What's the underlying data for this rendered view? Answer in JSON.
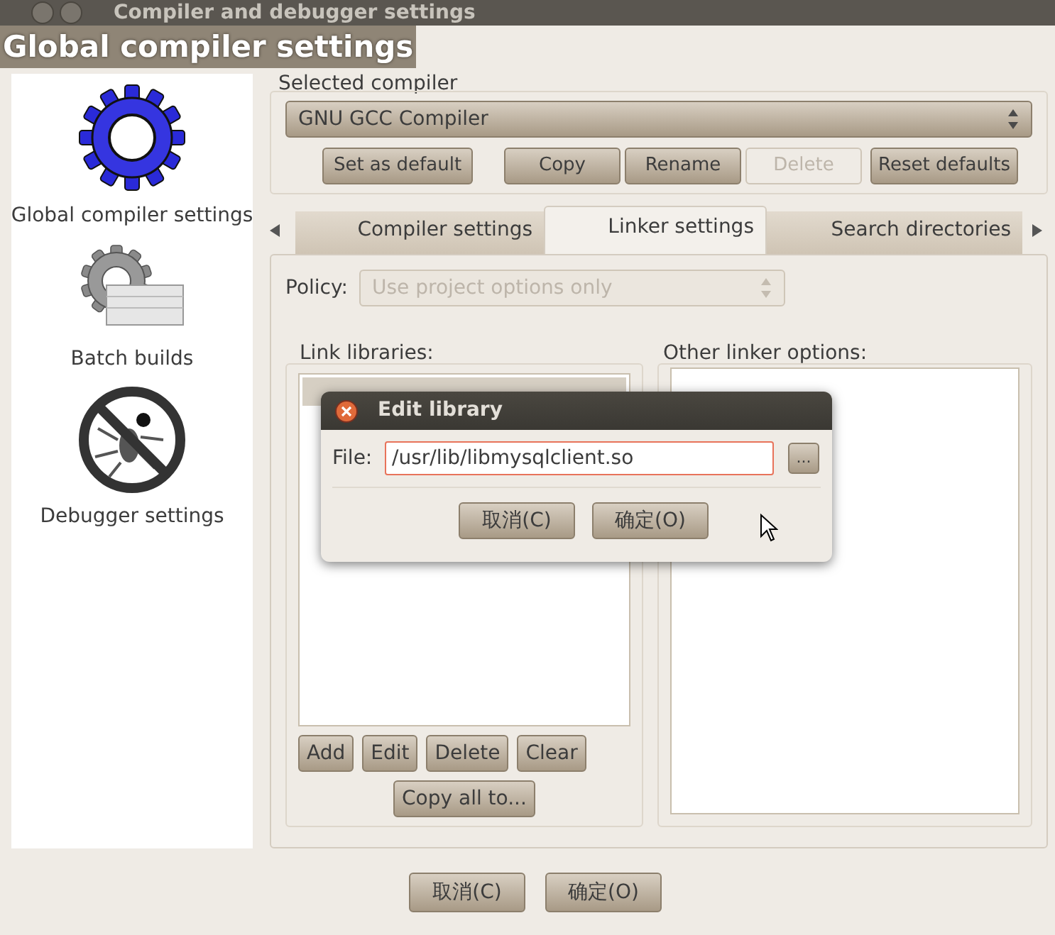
{
  "window": {
    "title": "Compiler and debugger settings",
    "heading": "Global compiler settings"
  },
  "sidebar": {
    "items": [
      {
        "label": "Global compiler settings",
        "kind": "gear"
      },
      {
        "label": "Batch builds",
        "kind": "batch"
      },
      {
        "label": "Debugger settings",
        "kind": "nobug"
      }
    ]
  },
  "selected_compiler": {
    "label": "Selected compiler",
    "value": "GNU GCC Compiler"
  },
  "compiler_buttons": [
    {
      "label": "Set as default",
      "disabled": false
    },
    {
      "label": "Copy",
      "disabled": false
    },
    {
      "label": "Rename",
      "disabled": false
    },
    {
      "label": "Delete",
      "disabled": true
    },
    {
      "label": "Reset defaults",
      "disabled": false
    }
  ],
  "tabs": [
    {
      "label": "Compiler settings",
      "selected": false
    },
    {
      "label": "Linker settings",
      "selected": true
    },
    {
      "label": "Search directories",
      "selected": false
    }
  ],
  "policy": {
    "label": "Policy:",
    "value": "Use project options only",
    "disabled": true
  },
  "link_libraries": {
    "label": "Link libraries:",
    "buttons": [
      "Add",
      "Edit",
      "Delete",
      "Clear"
    ],
    "copy_button": "Copy all to..."
  },
  "other_linker_options": {
    "label": "Other linker options:"
  },
  "dialog": {
    "title": "Edit library",
    "file_label": "File:",
    "file_value": "/usr/lib/libmysqlclient.so",
    "browse_label": "...",
    "buttons": [
      "取消(C)",
      "确定(O)"
    ]
  },
  "footer_buttons": [
    "取消(C)",
    "确定(O)"
  ]
}
